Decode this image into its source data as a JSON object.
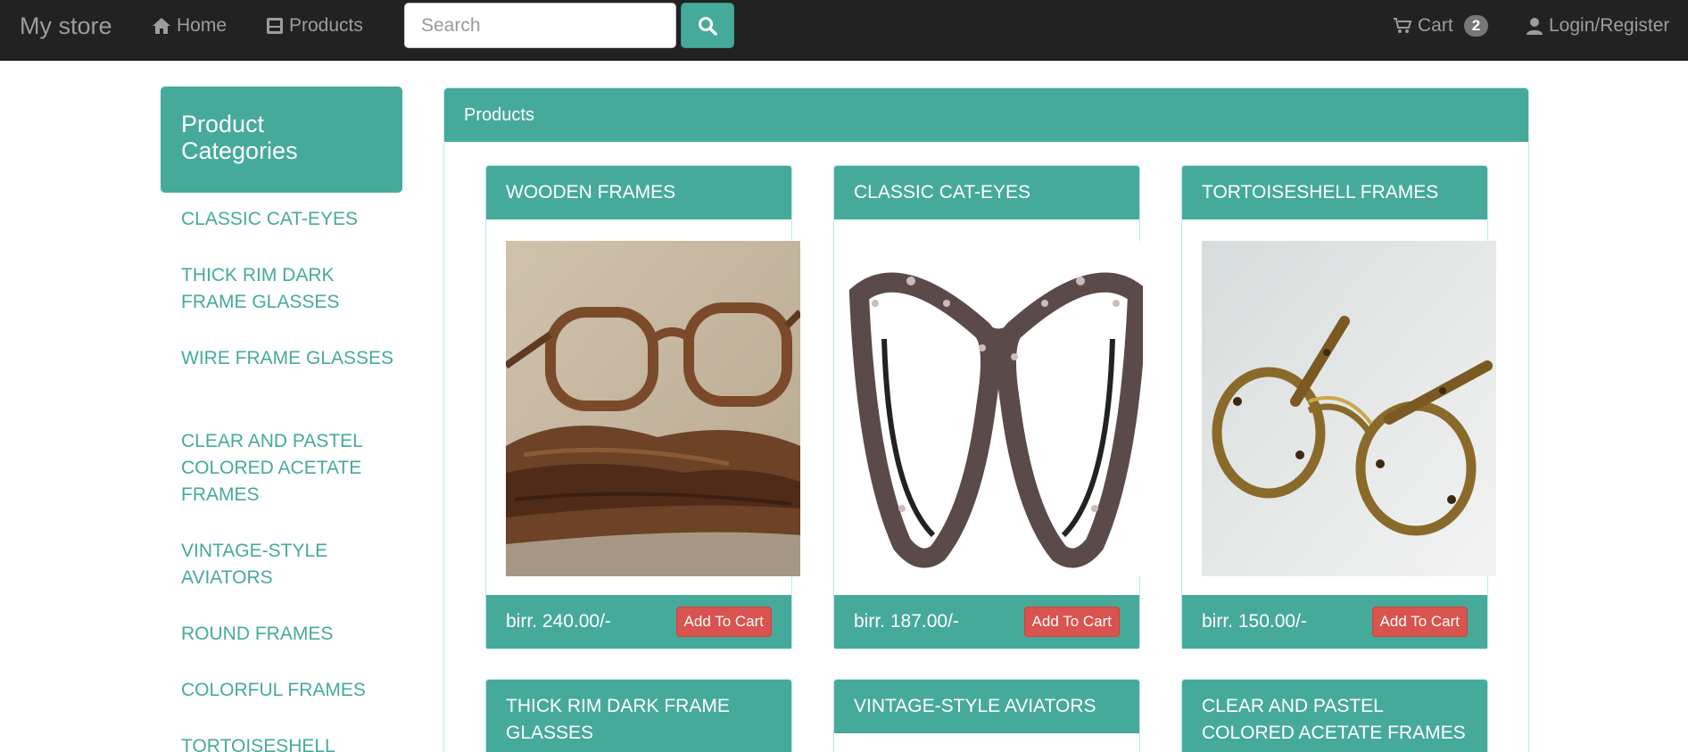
{
  "nav": {
    "brand": "My store",
    "home_label": "Home",
    "products_label": "Products",
    "search_placeholder": "Search",
    "cart_label": "Cart",
    "cart_count": "2",
    "login_label": "Login/Register"
  },
  "sidebar": {
    "title": "Product Categories",
    "items": [
      "CLASSIC CAT-EYES",
      "THICK RIM DARK FRAME GLASSES",
      "WIRE FRAME GLASSES",
      "CLEAR AND PASTEL COLORED ACETATE FRAMES",
      "VINTAGE-STYLE AVIATORS",
      "ROUND FRAMES",
      "COLORFUL FRAMES",
      "TORTOISESHELL"
    ]
  },
  "products_panel": {
    "title": "Products",
    "items": [
      {
        "name": "WOODEN FRAMES",
        "price": "birr. 240.00/-",
        "button": "Add To Cart"
      },
      {
        "name": "CLASSIC CAT-EYES",
        "price": "birr. 187.00/-",
        "button": "Add To Cart"
      },
      {
        "name": "TORTOISESHELL FRAMES",
        "price": "birr. 150.00/-",
        "button": "Add To Cart"
      },
      {
        "name": "THICK RIM DARK FRAME GLASSES"
      },
      {
        "name": "VINTAGE-STYLE AVIATORS"
      },
      {
        "name": "CLEAR AND PASTEL COLORED ACETATE FRAMES"
      }
    ]
  },
  "colors": {
    "accent": "#46aa9a",
    "navbar": "#222222",
    "danger": "#d9534f"
  },
  "icons": [
    "home-icon",
    "products-icon",
    "search-icon",
    "cart-icon",
    "user-icon"
  ]
}
